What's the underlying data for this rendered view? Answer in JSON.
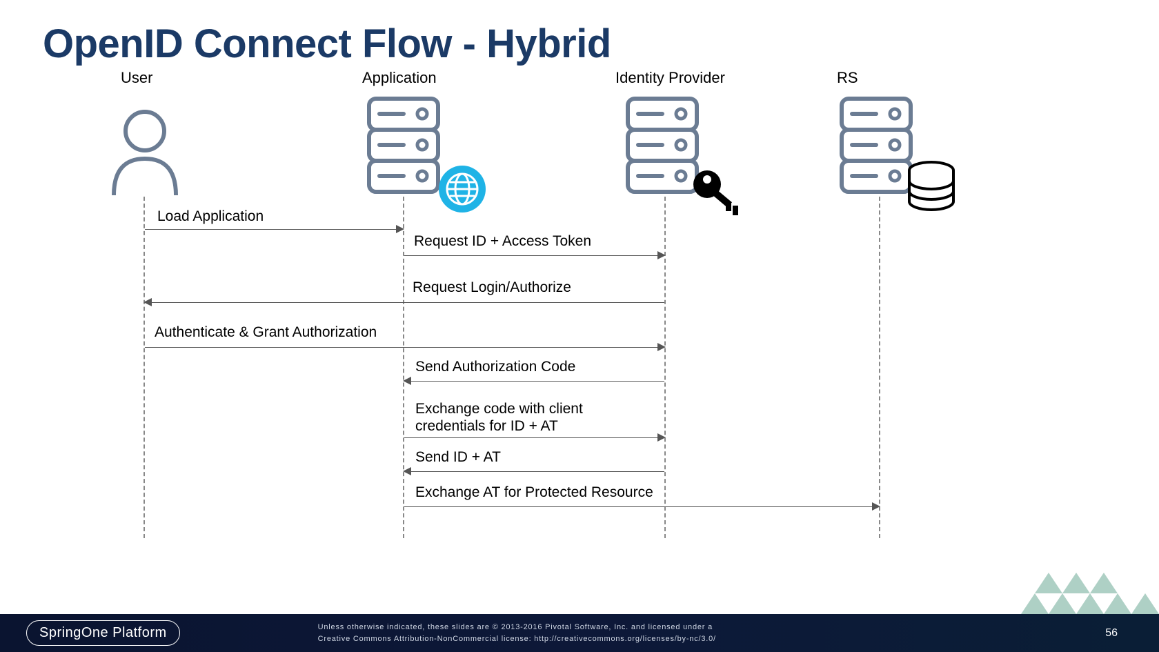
{
  "title": "OpenID Connect Flow - Hybrid",
  "actors": {
    "user": "User",
    "application": "Application",
    "idp": "Identity Provider",
    "rs": "RS"
  },
  "messages": {
    "m1": "Load Application",
    "m2": "Request ID + Access Token",
    "m3": "Request Login/Authorize",
    "m4": "Authenticate & Grant Authorization",
    "m5": "Send Authorization Code",
    "m6": "Exchange code with client credentials for ID + AT",
    "m7": "Send ID + AT",
    "m8": "Exchange AT for Protected Resource"
  },
  "footer": {
    "badge": "SpringOne Platform",
    "copyright_line1": "Unless otherwise indicated, these slides are © 2013-2016 Pivotal Software, Inc. and licensed under a",
    "copyright_line2": "Creative Commons Attribution-NonCommercial license: http://creativecommons.org/licenses/by-nc/3.0/",
    "page": "56"
  },
  "chart_data": {
    "type": "sequence_diagram",
    "title": "OpenID Connect Flow - Hybrid",
    "participants": [
      "User",
      "Application",
      "Identity Provider",
      "RS"
    ],
    "messages": [
      {
        "from": "User",
        "to": "Application",
        "label": "Load Application"
      },
      {
        "from": "Application",
        "to": "Identity Provider",
        "label": "Request ID + Access Token"
      },
      {
        "from": "Identity Provider",
        "to": "User",
        "label": "Request Login/Authorize"
      },
      {
        "from": "User",
        "to": "Identity Provider",
        "label": "Authenticate & Grant Authorization"
      },
      {
        "from": "Identity Provider",
        "to": "Application",
        "label": "Send Authorization Code"
      },
      {
        "from": "Application",
        "to": "Identity Provider",
        "label": "Exchange code with client credentials for ID + AT"
      },
      {
        "from": "Identity Provider",
        "to": "Application",
        "label": "Send ID + AT"
      },
      {
        "from": "Application",
        "to": "RS",
        "label": "Exchange AT for Protected Resource"
      }
    ]
  }
}
